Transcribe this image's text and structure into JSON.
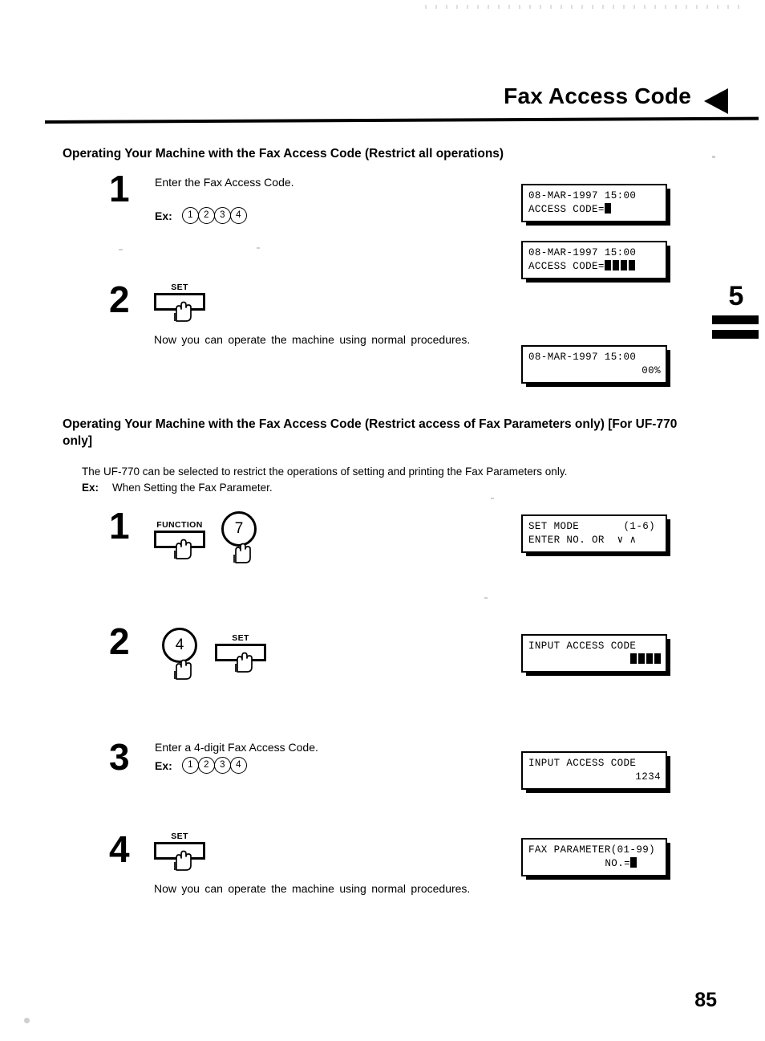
{
  "header": {
    "title": "Fax Access Code",
    "arrow_icon": "left-pointing-triangle"
  },
  "chapter_tab": {
    "number": "5"
  },
  "page_number": "85",
  "sections": [
    {
      "heading": "Operating Your Machine with the Fax Access Code (Restrict all operations)",
      "steps": [
        {
          "number": "1",
          "instruction": "Enter the Fax Access Code.",
          "example_label": "Ex:",
          "example_digits": [
            "1",
            "2",
            "3",
            "4"
          ]
        },
        {
          "number": "2",
          "key_label": "SET",
          "note": "Now you can operate the machine using normal procedures."
        }
      ]
    },
    {
      "heading": "Operating Your Machine with the Fax Access Code (Restrict access of Fax Parameters only) [For UF-770 only]",
      "intro": "The UF-770 can be selected to restrict the operations of setting and printing the Fax Parameters only.",
      "intro_example_label": "Ex:",
      "intro_example_text": "When Setting the Fax Parameter.",
      "steps": [
        {
          "number": "1",
          "key_function_label": "FUNCTION",
          "key_digit": "7"
        },
        {
          "number": "2",
          "key_digit": "4",
          "key_label": "SET"
        },
        {
          "number": "3",
          "instruction": "Enter a 4-digit Fax Access Code.",
          "example_label": "Ex:",
          "example_digits": [
            "1",
            "2",
            "3",
            "4"
          ]
        },
        {
          "number": "4",
          "key_label": "SET",
          "note": "Now you can operate the machine using normal procedures."
        }
      ]
    }
  ],
  "lcd_panels": {
    "panel1": {
      "line1": "08-MAR-1997 15:00",
      "line2_prefix": "ACCESS CODE="
    },
    "panel2": {
      "line1": "08-MAR-1997 15:00",
      "line2_prefix": "ACCESS CODE="
    },
    "panel3": {
      "line1": "08-MAR-1997 15:00",
      "line2": "00%"
    },
    "panel4": {
      "line1": "SET MODE       (1-6)",
      "line2": "ENTER NO. OR  ∨ ∧"
    },
    "panel5": {
      "line1": "INPUT ACCESS CODE",
      "line2": ""
    },
    "panel6": {
      "line1": "INPUT ACCESS CODE",
      "line2": "1234"
    },
    "panel7": {
      "line1": "FAX PARAMETER(01-99)",
      "line2": "NO.="
    }
  }
}
